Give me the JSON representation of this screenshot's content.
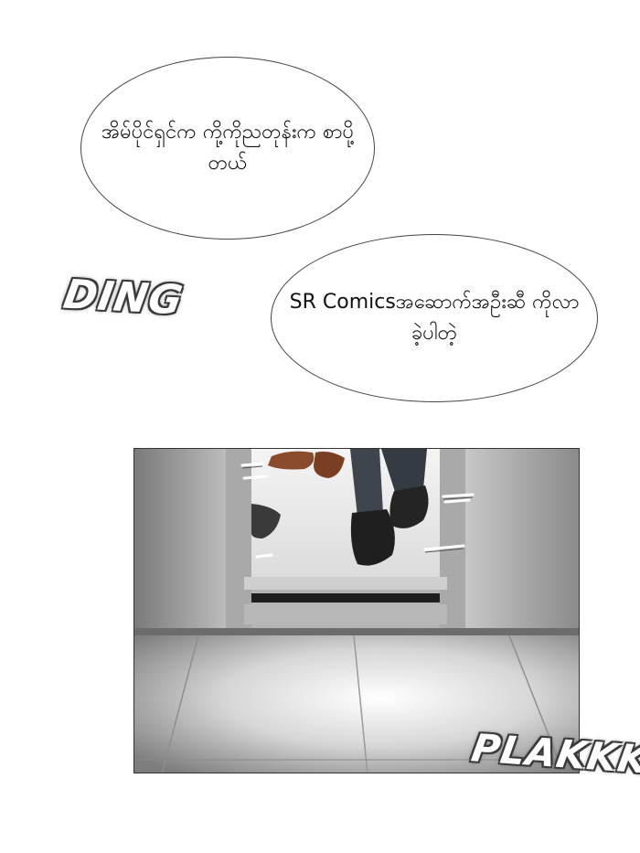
{
  "bubbles": [
    {
      "text": "အိမ်ပိုင်ရှင်က ကို့ကိုညတုန်းက စာပို့တယ်"
    },
    {
      "text": "SR Comicsအဆောက်အဦးဆီ ကိုလာခဲ့ပါတဲ့"
    }
  ],
  "sfx": {
    "ding": "DING",
    "plakkk": "PLAKKK"
  },
  "panel": {
    "scene": "elevator-doors-opening-feet"
  }
}
